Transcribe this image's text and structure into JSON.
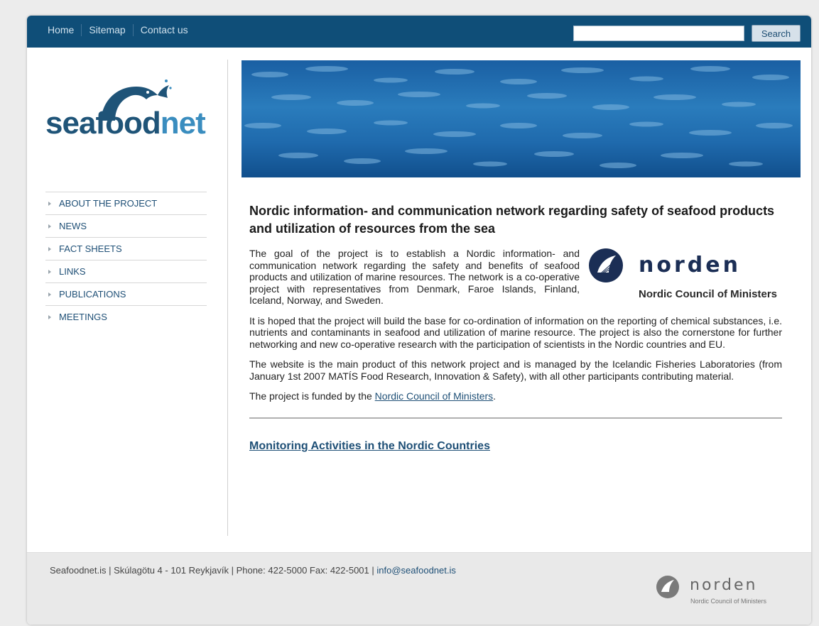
{
  "topnav": {
    "items": [
      {
        "label": "Home"
      },
      {
        "label": "Sitemap"
      },
      {
        "label": "Contact us"
      }
    ]
  },
  "search": {
    "value": "",
    "button_label": "Search"
  },
  "logo": {
    "text_part1": "sea",
    "text_part2": "food",
    "text_part3": "net"
  },
  "sidebar": {
    "items": [
      {
        "label": "ABOUT THE PROJECT"
      },
      {
        "label": "NEWS"
      },
      {
        "label": "FACT SHEETS"
      },
      {
        "label": "LINKS"
      },
      {
        "label": "PUBLICATIONS"
      },
      {
        "label": "MEETINGS"
      }
    ]
  },
  "main": {
    "headline": "Nordic information- and communication network regarding safety of seafood products and utilization of resources from the sea",
    "p1": "The goal of the project is to establish a Nordic information- and communication network regarding the safety and benefits of seafood products and utilization of marine resources. The network is a co-operative project with representatives from Denmark, Faroe Islands, Finland, Iceland, Norway, and Sweden.",
    "p2": "It is hoped that the project will build the base for co-ordination of information on the reporting of chemical substances, i.e. nutrients and contaminants in seafood and utilization of marine resource. The project is also the cornerstone for further networking and new co-operative research with the participation of scientists in the Nordic countries and EU.",
    "p3": "The website is the main product of this network project and is managed by the Icelandic Fisheries Laboratories (from January 1st 2007 MATÍS Food Research, Innovation & Safety), with all other participants contributing material.",
    "p4_prefix": "The project is funded by the ",
    "p4_link": "Nordic Council of Ministers",
    "p4_suffix": ".",
    "monitoring_link": "Monitoring Activities in the Nordic Countries"
  },
  "norden": {
    "word": "norden",
    "subtitle": "Nordic Council of Ministers"
  },
  "footer": {
    "text": "Seafoodnet.is | Skúlagötu 4 - 101 Reykjavík | Phone: 422-5000 Fax: 422-5001 | ",
    "email": "info@seafoodnet.is",
    "logo_word": "norden",
    "logo_sub": "Nordic Council of Ministers"
  },
  "colors": {
    "topbar": "#0f4e78",
    "link": "#1e4f76",
    "footer_bg": "#e9e9e9"
  }
}
